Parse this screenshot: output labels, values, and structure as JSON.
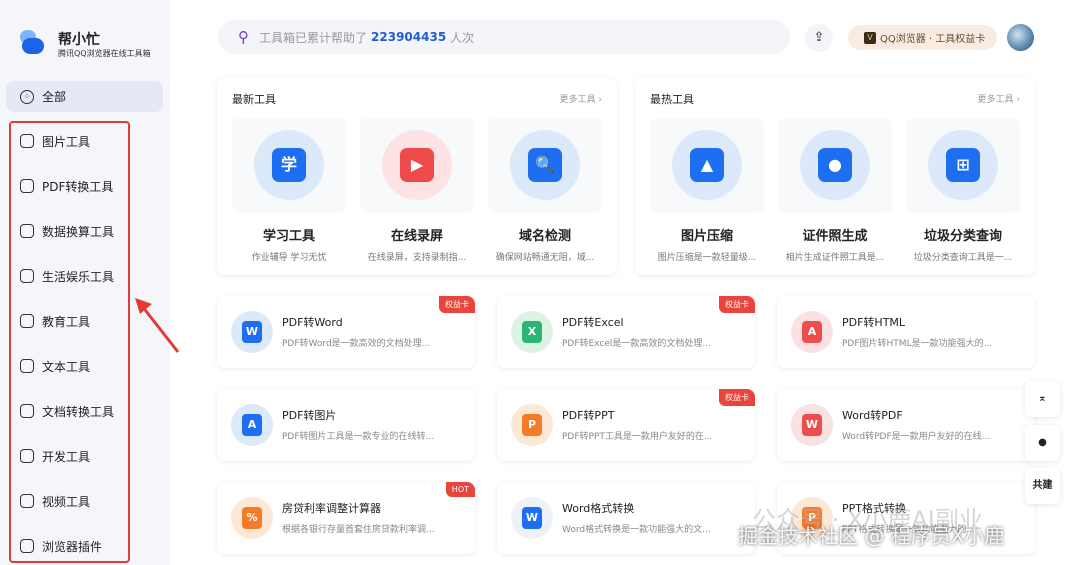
{
  "brand": {
    "name": "帮小忙",
    "subtitle": "腾讯QQ浏览器在线工具箱"
  },
  "sidebar": {
    "all": "全部",
    "items": [
      {
        "label": "图片工具",
        "icon": "image-icon"
      },
      {
        "label": "PDF转换工具",
        "icon": "pdf-icon"
      },
      {
        "label": "数据换算工具",
        "icon": "chart-icon"
      },
      {
        "label": "生活娱乐工具",
        "icon": "life-icon"
      },
      {
        "label": "教育工具",
        "icon": "education-icon"
      },
      {
        "label": "文本工具",
        "icon": "text-icon"
      },
      {
        "label": "文档转换工具",
        "icon": "doc-convert-icon"
      },
      {
        "label": "开发工具",
        "icon": "terminal-icon"
      },
      {
        "label": "视频工具",
        "icon": "video-icon"
      },
      {
        "label": "浏览器插件",
        "icon": "puzzle-icon"
      }
    ]
  },
  "search": {
    "prefix": "工具箱已累计帮助了",
    "count": "223904435",
    "suffix": "人次"
  },
  "header": {
    "badge": "QQ浏览器 · 工具权益卡",
    "badge_icon": "V"
  },
  "newest": {
    "title": "最新工具",
    "more": "更多工具 ›",
    "tiles": [
      {
        "title": "学习工具",
        "desc": "作业辅导 学习无忧",
        "glyph": "学",
        "color": "#1d6ef0",
        "bg": "#dbe9fb"
      },
      {
        "title": "在线录屏",
        "desc": "在线录屏，支持录制指...",
        "glyph": "▶",
        "color": "#ef4a4a",
        "bg": "#fde3e3"
      },
      {
        "title": "域名检测",
        "desc": "确保网站畅通无阻，域...",
        "glyph": "🔍",
        "color": "#1d6ef0",
        "bg": "#dbe9fb"
      }
    ]
  },
  "hottest": {
    "title": "最热工具",
    "more": "更多工具 ›",
    "tiles": [
      {
        "title": "图片压缩",
        "desc": "图片压缩是一款轻量级...",
        "glyph": "▲",
        "color": "#1d6ef0",
        "bg": "#dbe9fb"
      },
      {
        "title": "证件照生成",
        "desc": "相片生成证件照工具是...",
        "glyph": "●",
        "color": "#1d6ef0",
        "bg": "#dbe9fb"
      },
      {
        "title": "垃圾分类查询",
        "desc": "垃圾分类查询工具是一...",
        "glyph": "⊞",
        "color": "#1d6ef0",
        "bg": "#dbe9fb"
      }
    ]
  },
  "tools": [
    {
      "name": "PDF转Word",
      "desc": "PDF转Word是一款高效的文档处理...",
      "tag": "权益卡",
      "glyph": "W",
      "color": "#1d6ef0",
      "bg": "#dbe9fb"
    },
    {
      "name": "PDF转Excel",
      "desc": "PDF转Excel是一款高效的文档处理...",
      "tag": "权益卡",
      "glyph": "X",
      "color": "#2bb673",
      "bg": "#dcf3e6"
    },
    {
      "name": "PDF转HTML",
      "desc": "PDF图片转HTML是一款功能强大的...",
      "tag": null,
      "glyph": "A",
      "color": "#ec4d4d",
      "bg": "#fbe1e1"
    },
    {
      "name": "PDF转图片",
      "desc": "PDF转图片工具是一款专业的在线转...",
      "tag": null,
      "glyph": "A",
      "color": "#1d6ef0",
      "bg": "#dbe9fb"
    },
    {
      "name": "PDF转PPT",
      "desc": "PDF转PPT工具是一款用户友好的在...",
      "tag": "权益卡",
      "glyph": "P",
      "color": "#f47b2a",
      "bg": "#fde8d6"
    },
    {
      "name": "Word转PDF",
      "desc": "Word转PDF是一款用户友好的在线...",
      "tag": null,
      "glyph": "W",
      "color": "#ec4d4d",
      "bg": "#fbe1e1"
    },
    {
      "name": "房贷利率调整计算器",
      "desc": "根据各银行存量首套住房贷款利率调...",
      "tag": "HOT",
      "glyph": "%",
      "color": "#f47b2a",
      "bg": "#fde8d6"
    },
    {
      "name": "Word格式转换",
      "desc": "Word格式转换是一款功能强大的文...",
      "tag": null,
      "glyph": "W",
      "color": "#1d6ef0",
      "bg": "#eef2f8"
    },
    {
      "name": "PPT格式转换",
      "desc": "PPT格式转换是一款功能强大的...",
      "tag": null,
      "glyph": "P",
      "color": "#f47b2a",
      "bg": "#fde8d6"
    }
  ],
  "float": {
    "top": "⌅",
    "qq": "●",
    "cobuild": "共建"
  },
  "watermark": {
    "line1": "公众号 · X小鹿AI副业",
    "line2": "掘金技术社区 @ 程序员X小鹿"
  }
}
